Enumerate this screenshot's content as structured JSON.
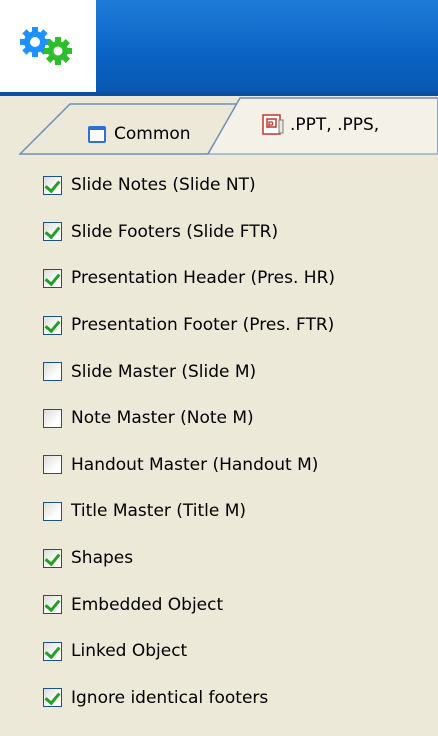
{
  "header": {
    "icon": "gears-icon",
    "colors": {
      "banner": "#0A62C2",
      "gear_blue": "#1E90FF",
      "gear_green": "#2DBE2D"
    }
  },
  "tabs": [
    {
      "label": "Common",
      "icon": "window-icon",
      "selected": false
    },
    {
      "label": ".PPT, .PPS,",
      "icon": "powerpoint-icon",
      "selected": true
    }
  ],
  "options": [
    {
      "label": "Slide Notes (Slide NT)",
      "checked": true
    },
    {
      "label": "Slide Footers (Slide FTR)",
      "checked": true
    },
    {
      "label": "Presentation Header (Pres. HR)",
      "checked": true
    },
    {
      "label": "Presentation Footer (Pres. FTR)",
      "checked": true
    },
    {
      "label": "Slide Master (Slide M)",
      "checked": false
    },
    {
      "label": "Note Master (Note M)",
      "checked": false
    },
    {
      "label": "Handout Master (Handout M)",
      "checked": false
    },
    {
      "label": "Title Master (Title M)",
      "checked": false
    },
    {
      "label": "Shapes",
      "checked": true
    },
    {
      "label": "Embedded Object",
      "checked": true
    },
    {
      "label": "Linked Object",
      "checked": true
    },
    {
      "label": "Ignore identical footers",
      "checked": true
    }
  ]
}
